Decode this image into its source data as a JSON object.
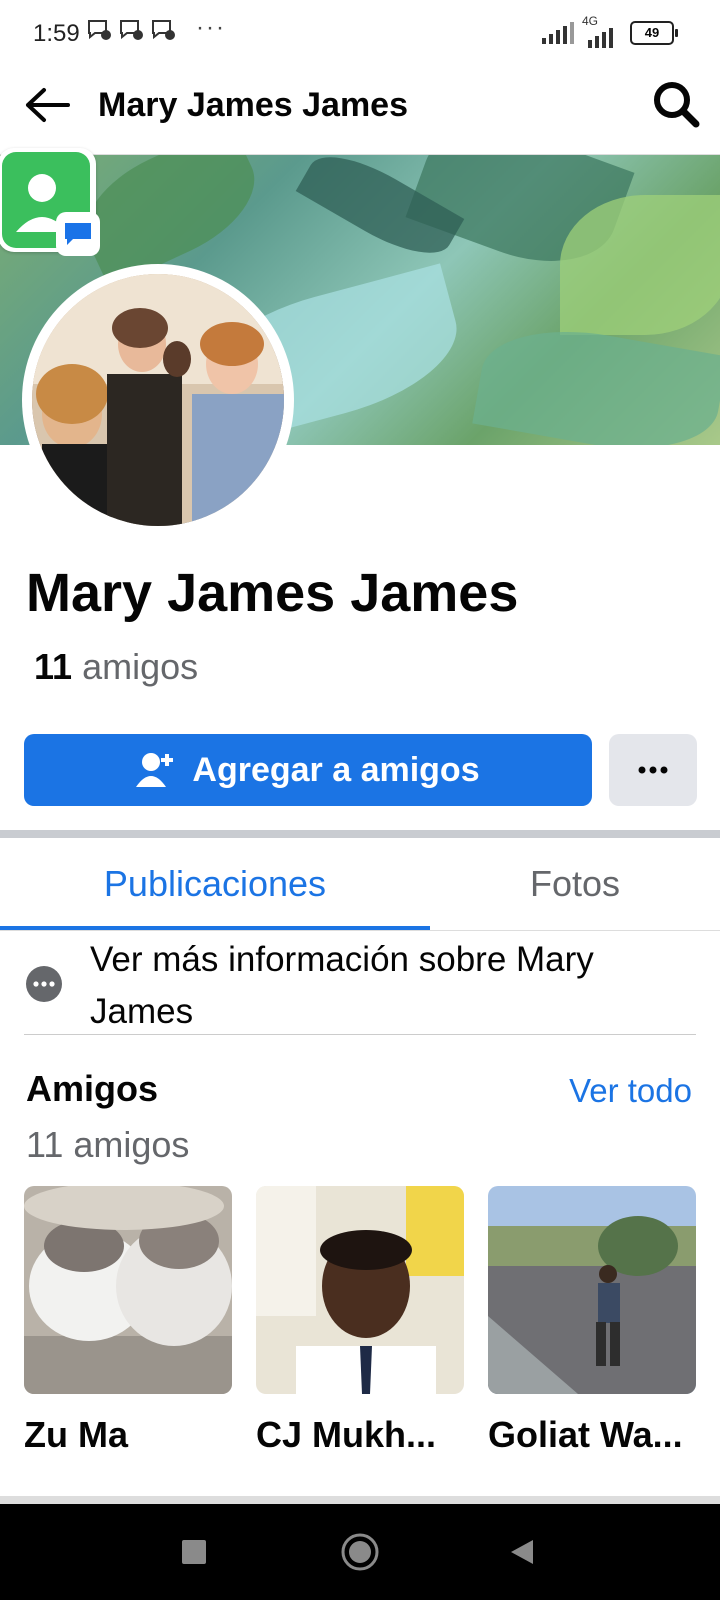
{
  "status_bar": {
    "time": "1:59",
    "more": "···",
    "network": "4G",
    "battery": "49"
  },
  "header": {
    "title": "Mary James James"
  },
  "profile": {
    "name": "Mary James James",
    "friend_count_num": "11",
    "friend_count_label": "amigos"
  },
  "actions": {
    "add_friend_label": "Agregar a amigos"
  },
  "tabs": [
    {
      "label": "Publicaciones",
      "active": true
    },
    {
      "label": "Fotos",
      "active": false
    }
  ],
  "more_info": {
    "label": "Ver más información sobre Mary James"
  },
  "friends": {
    "heading": "Amigos",
    "see_all": "Ver todo",
    "subtitle": "11 amigos",
    "items": [
      {
        "name": "Zu Ma"
      },
      {
        "name": "CJ Mukh..."
      },
      {
        "name": "Goliat Wa..."
      }
    ]
  },
  "icons": {
    "back": "arrow-left-icon",
    "search": "search-icon",
    "add_friend": "add-person-icon",
    "more": "more-horizontal-icon",
    "info": "more-circle-icon"
  },
  "colors": {
    "brand_blue": "#1b74e4",
    "secondary_text": "#65676b",
    "button_grey": "#e4e6eb"
  }
}
